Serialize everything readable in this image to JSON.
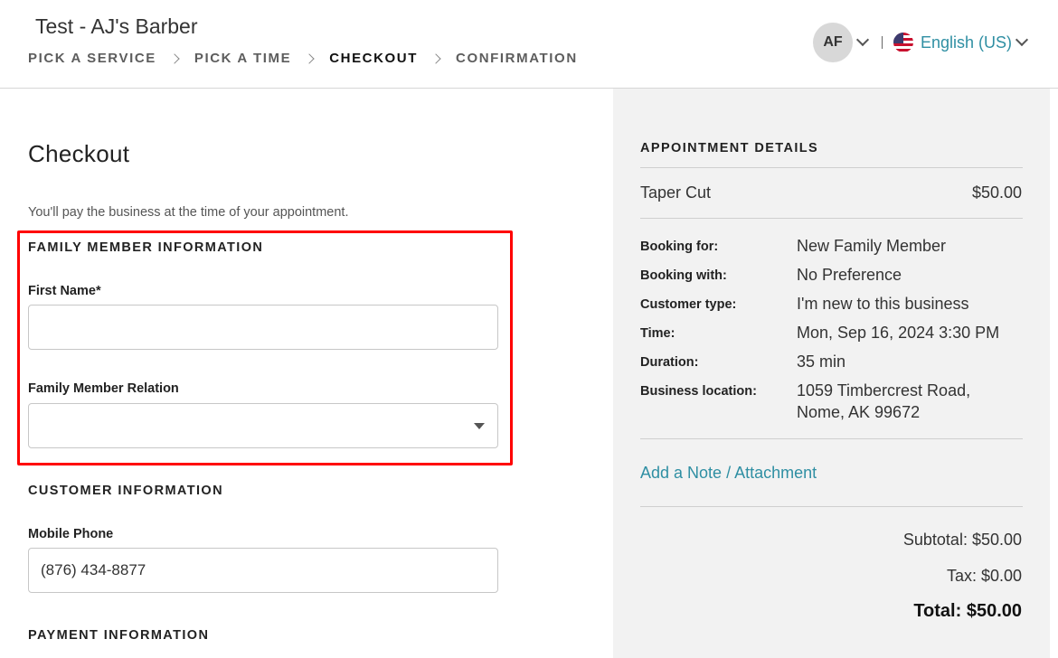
{
  "header": {
    "business_name": "Test - AJ's Barber",
    "steps": [
      "PICK A SERVICE",
      "PICK A TIME",
      "CHECKOUT",
      "CONFIRMATION"
    ],
    "active_step": "CHECKOUT",
    "avatar_initials": "AF",
    "language": "English (US)"
  },
  "checkout": {
    "title": "Checkout",
    "pay_note": "You'll pay the business at the time of your appointment.",
    "family_section": "FAMILY MEMBER INFORMATION",
    "first_name_label": "First Name*",
    "first_name_value": "",
    "relation_label": "Family Member Relation",
    "relation_value": "",
    "customer_section": "CUSTOMER INFORMATION",
    "mobile_label": "Mobile Phone",
    "mobile_value": "(876) 434-8877",
    "payment_section": "PAYMENT INFORMATION"
  },
  "appointment": {
    "title": "APPOINTMENT DETAILS",
    "service": "Taper Cut",
    "price": "$50.00",
    "details": [
      {
        "label": "Booking for:",
        "value": "New Family Member"
      },
      {
        "label": "Booking with:",
        "value": "No Preference"
      },
      {
        "label": "Customer type:",
        "value": "I'm new to this business"
      },
      {
        "label": "Time:",
        "value": "Mon, Sep 16, 2024 3:30 PM"
      },
      {
        "label": "Duration:",
        "value": "35 min"
      },
      {
        "label": "Business location:",
        "value": "1059 Timbercrest Road,",
        "value2": "Nome, AK 99672"
      }
    ],
    "note_link": "Add a Note / Attachment",
    "subtotal": "Subtotal: $50.00",
    "tax": "Tax: $0.00",
    "total": "Total: $50.00"
  },
  "colors": {
    "accent": "#2f8fa3",
    "highlight": "#ff0000",
    "sidebar_bg": "#f2f2f2"
  }
}
